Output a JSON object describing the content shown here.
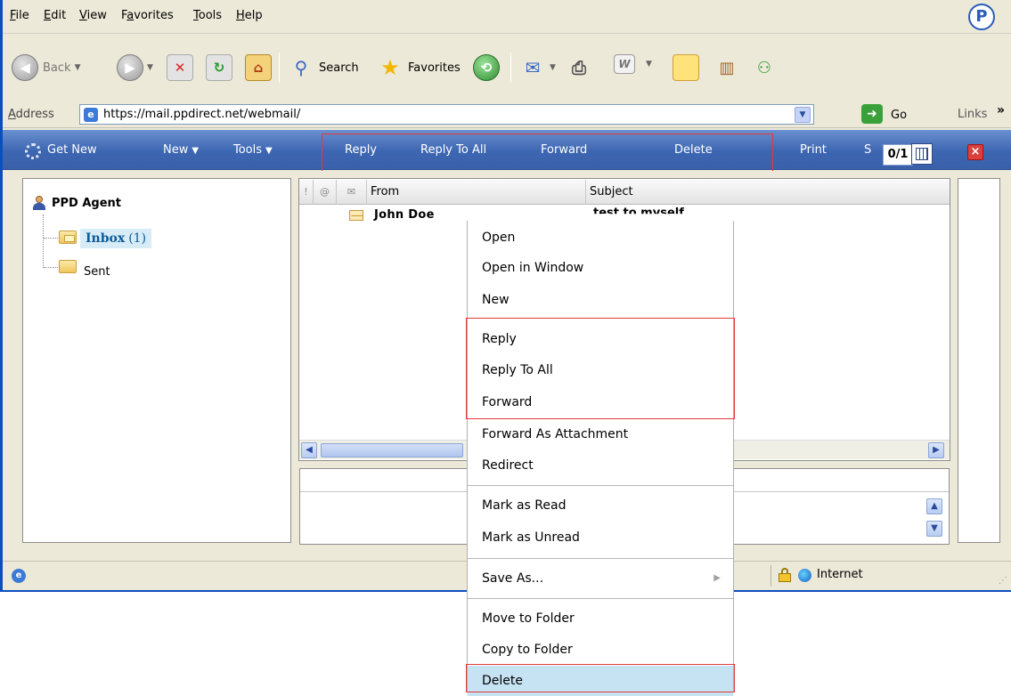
{
  "menubar": {
    "items": [
      "File",
      "Edit",
      "View",
      "Favorites",
      "Tools",
      "Help"
    ],
    "underlines": [
      "F",
      "E",
      "V",
      "a",
      "T",
      "H"
    ],
    "logo": "P"
  },
  "toolbar": {
    "back_label": "Back",
    "search_label": "Search",
    "favorites_label": "Favorites",
    "word_glyph": "W"
  },
  "address": {
    "label_prefix": "A",
    "label_rest": "ddress",
    "url": "https://mail.ppdirect.net/webmail/",
    "go_label": "Go",
    "links_label": "Links",
    "links_chevron": "»"
  },
  "app_toolbar": {
    "get_new": "Get New",
    "new": "New",
    "tools": "Tools",
    "reply": "Reply",
    "reply_all": "Reply To All",
    "forward": "Forward",
    "delete": "Delete",
    "print": "Print",
    "cut_letter": "S",
    "counter": "0/1",
    "close_glyph": "×"
  },
  "folders": {
    "account": "PPD Agent",
    "inbox_label": "Inbox",
    "inbox_count": "(1)",
    "sent_label": "Sent"
  },
  "list": {
    "columns": {
      "flag_glyph": "!",
      "attach_glyph": "@",
      "read_glyph": "✉",
      "from": "From",
      "subject": "Subject"
    },
    "rows": [
      {
        "from": "John Doe",
        "subject": "test to myself"
      }
    ]
  },
  "status": {
    "zone": "Internet"
  },
  "context_menu": {
    "items": [
      "Open",
      "Open in Window",
      "New",
      "Reply",
      "Reply To All",
      "Forward",
      "Forward As Attachment",
      "Redirect",
      "Mark as Read",
      "Mark as Unread",
      "Save As...",
      "Move to Folder",
      "Copy to Folder",
      "Delete"
    ]
  },
  "colors": {
    "app_toolbar": "#3d66b2",
    "highlight_box": "#e23a3a",
    "menu_highlight": "#c6e3f3",
    "window_frame": "#0a4fbd"
  }
}
